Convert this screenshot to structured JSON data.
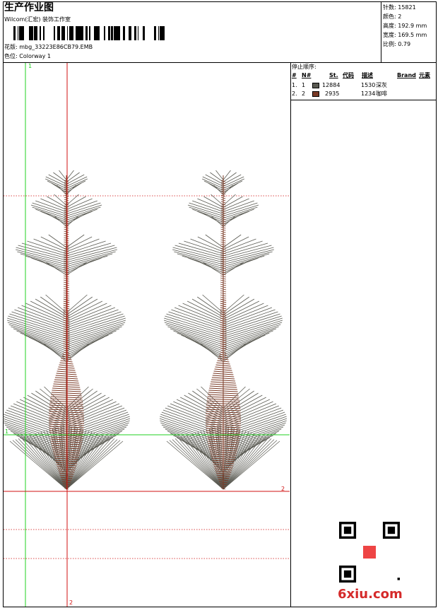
{
  "header": {
    "title": "生产作业图",
    "company": "Wilcom(汇宏) 装饰工作室",
    "design_file": "花版: mbg_33223E86CB79.EMB",
    "colorway": "色位: Colorway 1"
  },
  "stats": [
    "针数: 15821",
    "颜色: 2",
    "高度: 192.9 mm",
    "宽度: 169.5 mm",
    "比例: 0.79"
  ],
  "stop_sequence": {
    "title": "停止顺序:",
    "headers": [
      "#",
      "N#",
      "St.",
      "代码",
      "描述",
      "Brand",
      "元素"
    ],
    "rows": [
      {
        "index": "1.",
        "n": "1",
        "stitches": "12884",
        "code": "1530",
        "desc": "深灰",
        "color": "#5a5a52"
      },
      {
        "index": "2.",
        "n": "2",
        "stitches": "2935",
        "code": "1234",
        "desc": "咖啡",
        "color": "#7a3a26"
      }
    ]
  },
  "guides": {
    "green_x_label": "1",
    "green_y_label": "1",
    "red_x_label": "2",
    "red_y_label": "2"
  },
  "watermark": "6xiu.com",
  "colors": {
    "stitch_gray": "#5a5a52",
    "stitch_brown": "#7a3a26",
    "guide_green": "#20d020",
    "guide_red": "#d01010"
  }
}
